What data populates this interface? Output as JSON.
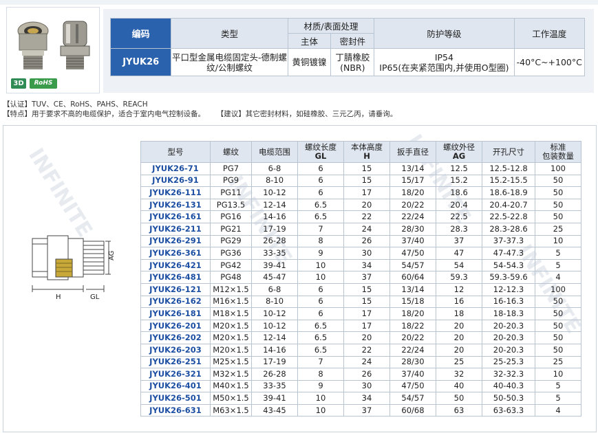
{
  "badges": {
    "d3": "3D",
    "rohs": "RoHS"
  },
  "spec": {
    "headers": {
      "code": "编码",
      "type": "类型",
      "material": "材质/表面处理",
      "main": "主体",
      "seal": "密封件",
      "protection": "防护等级",
      "temp": "工作温度"
    },
    "row": {
      "code": "JYUK26",
      "type": "平口型金属电缆固定头-德制螺纹/公制螺纹",
      "main": "黄铜镀镍",
      "seal": "丁腈橡胶(NBR)",
      "protection_line1": "IP54",
      "protection_line2": "IP65(在夹紧范围内,并使用O型圈)",
      "temp": "-40°C~+100°C"
    }
  },
  "cert_text": "【认证】TUV、CE、RoHS、PAHS、REACH",
  "feature_text": "【特点】用于要求不高的电缆保护，适合于室内电气控制设备。",
  "suggest_text": "【建议】其它密封材料，如硅橡胶、三元乙丙，请垂询。",
  "watermark": "INFINITE",
  "drawing_labels": {
    "ag": "AG",
    "h": "H",
    "gl": "GL"
  },
  "table": {
    "headers": {
      "model": "型号",
      "thread": "螺纹",
      "cable": "电缆范围",
      "thread_len": "螺纹长度",
      "thread_len_sub": "GL",
      "body_h": "本体高度",
      "body_h_sub": "H",
      "wrench": "扳手直径",
      "od": "螺纹外径",
      "od_sub": "AG",
      "hole": "开孔尺寸",
      "pack": "标准",
      "pack_sub": "包装数量"
    },
    "rows": [
      [
        "JYUK26-71",
        "PG7",
        "6-8",
        "6",
        "15",
        "13/14",
        "12.5",
        "12.5-12.8",
        "100"
      ],
      [
        "JYUK26-91",
        "PG9",
        "8-10",
        "6",
        "15",
        "15/17",
        "15.2",
        "15.2-15.5",
        "50"
      ],
      [
        "JYUK26-111",
        "PG11",
        "10-12",
        "6",
        "17",
        "18/20",
        "18.6",
        "18.6-18.9",
        "50"
      ],
      [
        "JYUK26-131",
        "PG13.5",
        "12-14",
        "6.5",
        "20",
        "20/22",
        "20.4",
        "20.4-20.7",
        "50"
      ],
      [
        "JYUK26-161",
        "PG16",
        "14-16",
        "6.5",
        "22",
        "22/24",
        "22.5",
        "22.5-22.8",
        "50"
      ],
      [
        "JYUK26-211",
        "PG21",
        "17-19",
        "7",
        "24",
        "28/30",
        "28.3",
        "28.3-28.6",
        "25"
      ],
      [
        "JYUK26-291",
        "PG29",
        "26-28",
        "8",
        "26",
        "37/40",
        "37",
        "37-37.3",
        "10"
      ],
      [
        "JYUK26-361",
        "PG36",
        "33-35",
        "9",
        "30",
        "47/50",
        "47",
        "47-47.3",
        "5"
      ],
      [
        "JYUK26-421",
        "PG42",
        "39-41",
        "10",
        "34",
        "54/57",
        "54",
        "54-54.3",
        "5"
      ],
      [
        "JYUK26-481",
        "PG48",
        "45-47",
        "10",
        "37",
        "60/64",
        "59.3",
        "59.3-59.6",
        "4"
      ],
      [
        "JYUK26-121",
        "M12×1.5",
        "6-8",
        "6",
        "15",
        "13/14",
        "12",
        "12-12.3",
        "100"
      ],
      [
        "JYUK26-162",
        "M16×1.5",
        "8-10",
        "6",
        "15",
        "15/18",
        "16",
        "16-16.3",
        "50"
      ],
      [
        "JYUK26-181",
        "M18×1.5",
        "10-12",
        "6",
        "17",
        "18/20",
        "18",
        "18-18.3",
        "50"
      ],
      [
        "JYUK26-201",
        "M20×1.5",
        "10-12",
        "6.5",
        "17",
        "18/22",
        "20",
        "20-20.3",
        "50"
      ],
      [
        "JYUK26-202",
        "M20×1.5",
        "12-14",
        "6.5",
        "20",
        "20/22",
        "20",
        "20-20.3",
        "50"
      ],
      [
        "JYUK26-203",
        "M20×1.5",
        "14-16",
        "6.5",
        "22",
        "22/24",
        "20",
        "20-20.3",
        "50"
      ],
      [
        "JYUK26-251",
        "M25×1.5",
        "17-19",
        "7",
        "24",
        "28/30",
        "25",
        "25-25.3",
        "25"
      ],
      [
        "JYUK26-321",
        "M32×1.5",
        "26-28",
        "8",
        "26",
        "37/40",
        "32",
        "32-32.3",
        "10"
      ],
      [
        "JYUK26-401",
        "M40×1.5",
        "33-35",
        "9",
        "30",
        "47/50",
        "40",
        "40-40.3",
        "5"
      ],
      [
        "JYUK26-501",
        "M50×1.5",
        "39-41",
        "10",
        "34",
        "54/57",
        "50",
        "50-50.3",
        "5"
      ],
      [
        "JYUK26-631",
        "M63×1.5",
        "43-45",
        "10",
        "37",
        "60/68",
        "63",
        "63-63.3",
        "4"
      ]
    ]
  }
}
